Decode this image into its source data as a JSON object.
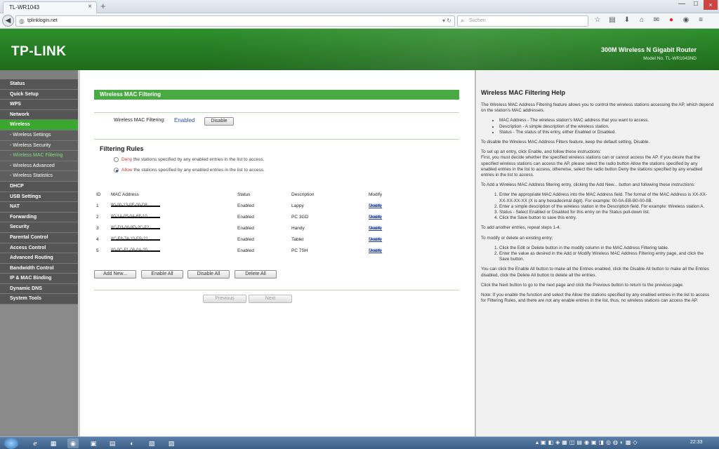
{
  "browser": {
    "tab_title": "TL-WR1043",
    "tab_close": "×",
    "new_tab": "+",
    "back": "◀",
    "url": "tplinklogin.net",
    "search_placeholder": "Suchen",
    "window_controls": [
      "—",
      "□",
      "×"
    ]
  },
  "header": {
    "logo": "TP-LINK",
    "model_title": "300M Wireless N Gigabit Router",
    "model_no": "Model No. TL-WR1043ND"
  },
  "sidebar": {
    "items": [
      {
        "label": "Status",
        "type": "main"
      },
      {
        "label": "Quick Setup",
        "type": "main"
      },
      {
        "label": "WPS",
        "type": "main"
      },
      {
        "label": "Network",
        "type": "main"
      },
      {
        "label": "Wireless",
        "type": "main",
        "active": true
      },
      {
        "label": "- Wireless Settings",
        "type": "sub"
      },
      {
        "label": "- Wireless Security",
        "type": "sub"
      },
      {
        "label": "- Wireless MAC Filtering",
        "type": "sub",
        "active": true
      },
      {
        "label": "- Wireless Advanced",
        "type": "sub"
      },
      {
        "label": "- Wireless Statistics",
        "type": "sub"
      },
      {
        "label": "DHCP",
        "type": "main"
      },
      {
        "label": "USB Settings",
        "type": "main"
      },
      {
        "label": "NAT",
        "type": "main"
      },
      {
        "label": "Forwarding",
        "type": "main"
      },
      {
        "label": "Security",
        "type": "main"
      },
      {
        "label": "Parental Control",
        "type": "main"
      },
      {
        "label": "Access Control",
        "type": "main"
      },
      {
        "label": "Advanced Routing",
        "type": "main"
      },
      {
        "label": "Bandwidth Control",
        "type": "main"
      },
      {
        "label": "IP & MAC Binding",
        "type": "main"
      },
      {
        "label": "Dynamic DNS",
        "type": "main"
      },
      {
        "label": "System Tools",
        "type": "main"
      }
    ]
  },
  "main": {
    "panel_title": "Wireless MAC Filtering",
    "mac_filtering_label": "Wireless MAC Filtering:",
    "mac_filtering_status": "Enabled",
    "disable_button": "Disable",
    "filtering_rules_title": "Filtering Rules",
    "rule_deny_word": "Deny",
    "rule_deny_rest": " the stations specified by any enabled entries in the list to access.",
    "rule_allow_word": "Allow",
    "rule_allow_rest": " the stations specified by any enabled entries in the list to access.",
    "table": {
      "headers": {
        "id": "ID",
        "mac": "MAC Address",
        "status": "Status",
        "description": "Description",
        "modify": "Modify"
      },
      "rows": [
        {
          "id": "1",
          "mac": "90-00-13-0E-00-D8",
          "status": "Enabled",
          "description": "Lappy",
          "modify": "Modify",
          "delete": "Delete"
        },
        {
          "id": "2",
          "mac": "00-1A-05-0A-6F-10",
          "status": "Enabled",
          "description": "PC 3GD",
          "modify": "Modify",
          "delete": "Delete"
        },
        {
          "id": "3",
          "mac": "0C-D3-00-9D-2C-F2",
          "status": "Enabled",
          "description": "Handy",
          "modify": "Modify",
          "delete": "Delete"
        },
        {
          "id": "4",
          "mac": "0C-F8-74-10-EB-22",
          "status": "Enabled",
          "description": "Tablet",
          "modify": "Modify",
          "delete": "Delete"
        },
        {
          "id": "5",
          "mac": "00-0C-F1-08-0A-20",
          "status": "Enabled",
          "description": "PC 7SH",
          "modify": "Modify",
          "delete": "Delete"
        }
      ]
    },
    "buttons": {
      "add_new": "Add New...",
      "enable_all": "Enable All",
      "disable_all": "Disable All",
      "delete_all": "Delete All",
      "previous": "Previous",
      "next": "Next"
    }
  },
  "help": {
    "title": "Wireless MAC Filtering Help",
    "intro": "The Wireless MAC Address Filtering feature allows you to control the wireless stations accessing the AP, which depend on the station's MAC addresses.",
    "bullets": [
      "MAC Address - The wireless station's MAC address that you want to access.",
      "Description - A simple description of the wireless station.",
      "Status - The status of this entry, either Enabled or Disabled."
    ],
    "disable_note": "To disable the Wireless MAC Address Filters feature, keep the default setting, Disable.",
    "setup_intro": "To set up an entry, click Enable, and follow these instructions:",
    "setup_text": "First, you must decide whether the specified wireless stations can or cannot access the AP. If you desire that the specified wireless stations can access the AP, please select the radio button Allow the stations specified by any enabled entries in the list to access, otherwise, select the radio button Deny the stations specified by any enabled entries in the list to access.",
    "add_intro": "To Add a Wireless MAC Address filtering entry, clicking the Add New... button and following these instructions:",
    "add_steps": [
      "Enter the appropriate MAC Address into the MAC Address field. The format of the MAC Address is XX-XX-XX-XX-XX-XX (X is any hexadecimal digit). For example: 00-0A-EB-B0-00-0B.",
      "Enter a simple description of the wireless station in the Description field. For example: Wireless station A.",
      "Status - Select Enabled or Disabled for this entry on the Status pull-down list.",
      "Click the Save button to save this entry."
    ],
    "repeat_note": "To add another entries, repeat steps 1-4.",
    "modify_intro": "To modify or delete an existing entry:",
    "modify_steps": [
      "Click the Edit or Delete button in the modify column in the MAC Address Filtering table.",
      "Enter the value as desired in the Add or Modify Wireless MAC Address Filtering entry page, and click the Save button."
    ],
    "enable_all_note": "You can click the Enable All button to make all the Entries enabled, click the Disable All button to make all the Entries disabled, click the Delete All button to delete all the entries.",
    "next_note": "Click the Next button to go to the next page and click the Previous button to return to the previous page.",
    "final_note": "Note: If you enable the function and select the Allow the stations specified by any enabled entries in the list to access for Filtering Rules, and there are not any enable entries in the list, thus, no wireless stations can access the AP."
  },
  "taskbar": {
    "clock": "22:33"
  }
}
